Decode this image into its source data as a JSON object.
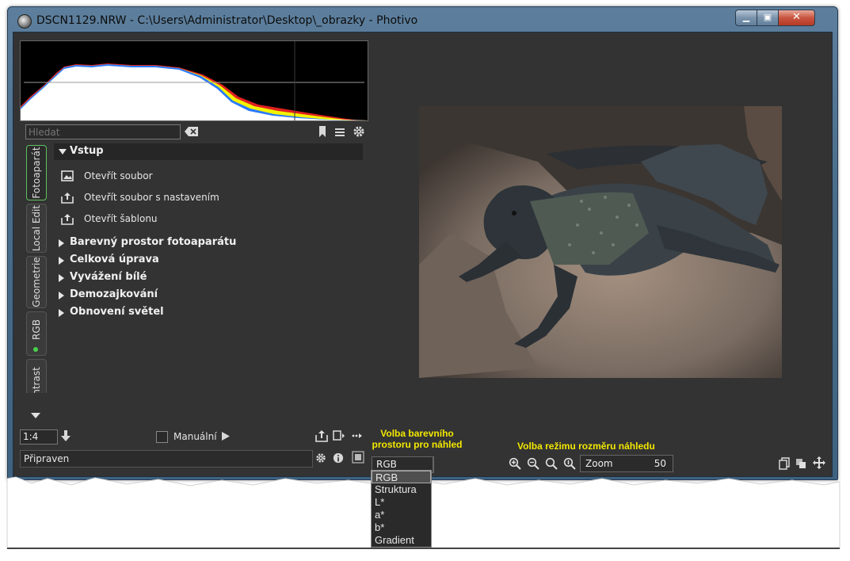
{
  "window": {
    "title": "DSCN1129.NRW - C:\\Users\\Administrator\\Desktop\\_obrazky - Photivo",
    "minimize_glyph": "▁",
    "maximize_glyph": "▣",
    "close_glyph": "✕"
  },
  "search": {
    "placeholder": "Hledat"
  },
  "tabs": [
    {
      "label": "Fotoaparát",
      "active": true
    },
    {
      "label": "Local Edit",
      "active": false
    },
    {
      "label": "Geometrie",
      "active": false
    },
    {
      "label": "RGB",
      "active": false,
      "indicator": true
    },
    {
      "label": "ntrast",
      "active": false
    }
  ],
  "panel": {
    "open_section": "Vstup",
    "actions": [
      {
        "label": "Otevřít soubor",
        "icon": "open-image-icon"
      },
      {
        "label": "Otevřít soubor s nastavením",
        "icon": "open-with-settings-icon"
      },
      {
        "label": "Otevřít šablonu",
        "icon": "open-template-icon"
      }
    ],
    "sections": [
      "Barevný prostor fotoaparátu",
      "Celková úprava",
      "Vyvážení bílé",
      "Demozajkování",
      "Obnovení světel"
    ]
  },
  "bottom_left": {
    "zoom_ratio": "1:4",
    "manual_label": "Manuální",
    "status": "Připraven"
  },
  "center_bottom": {
    "colorspace_value": "RGB",
    "zoom_mode_label": "Zoom",
    "zoom_mode_value": "50"
  },
  "annotations": {
    "colorspace_line1": "Volba barevního",
    "colorspace_line2": "prostoru pro náhled",
    "zoom": "Volba režimu rozměru náhledu"
  },
  "dropdown": {
    "options": [
      "RGB",
      "Struktura",
      "L*",
      "a*",
      "b*",
      "Gradient"
    ],
    "selected": "RGB"
  },
  "colors": {
    "panel_bg": "#333333",
    "annotation": "#f3e800",
    "active_tab_border": "#5fc05f"
  }
}
